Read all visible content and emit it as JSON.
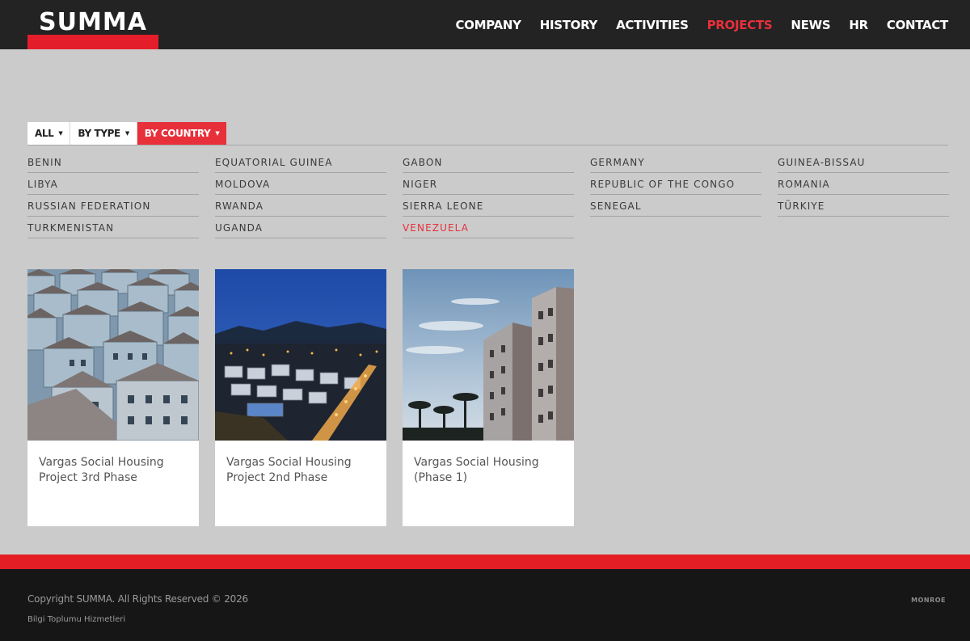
{
  "header": {
    "logo": "SUMMA",
    "nav": [
      "COMPANY",
      "HISTORY",
      "ACTIVITIES",
      "PROJECTS",
      "NEWS",
      "HR",
      "CONTACT"
    ],
    "active_nav": "PROJECTS",
    "accent_color": "#e8303b"
  },
  "filter": {
    "all_label": "ALL",
    "type_label": "BY TYPE",
    "country_label": "BY COUNTRY",
    "caret_icon": "caret-down-icon",
    "active": "BY COUNTRY"
  },
  "countries": [
    "BENIN",
    "EQUATORIAL GUINEA",
    "GABON",
    "GERMANY",
    "GUINEA-BISSAU",
    "LIBYA",
    "MOLDOVA",
    "NIGER",
    "REPUBLIC OF THE CONGO",
    "ROMANIA",
    "RUSSIAN FEDERATION",
    "RWANDA",
    "SIERRA LEONE",
    "SENEGAL",
    "TÜRKIYE",
    "TURKMENISTAN",
    "UGANDA",
    "VENEZUELA"
  ],
  "active_country": "VENEZUELA",
  "projects": [
    {
      "title": "Vargas Social Housing Project 3rd Phase"
    },
    {
      "title": "Vargas Social Housing Project 2nd Phase"
    },
    {
      "title": "Vargas Social Housing (Phase 1)"
    }
  ],
  "footer": {
    "copyright": "Copyright SUMMA. All Rights Reserved © 2026",
    "sub": "Bilgi Toplumu Hizmetleri",
    "agency": "MONROE"
  }
}
